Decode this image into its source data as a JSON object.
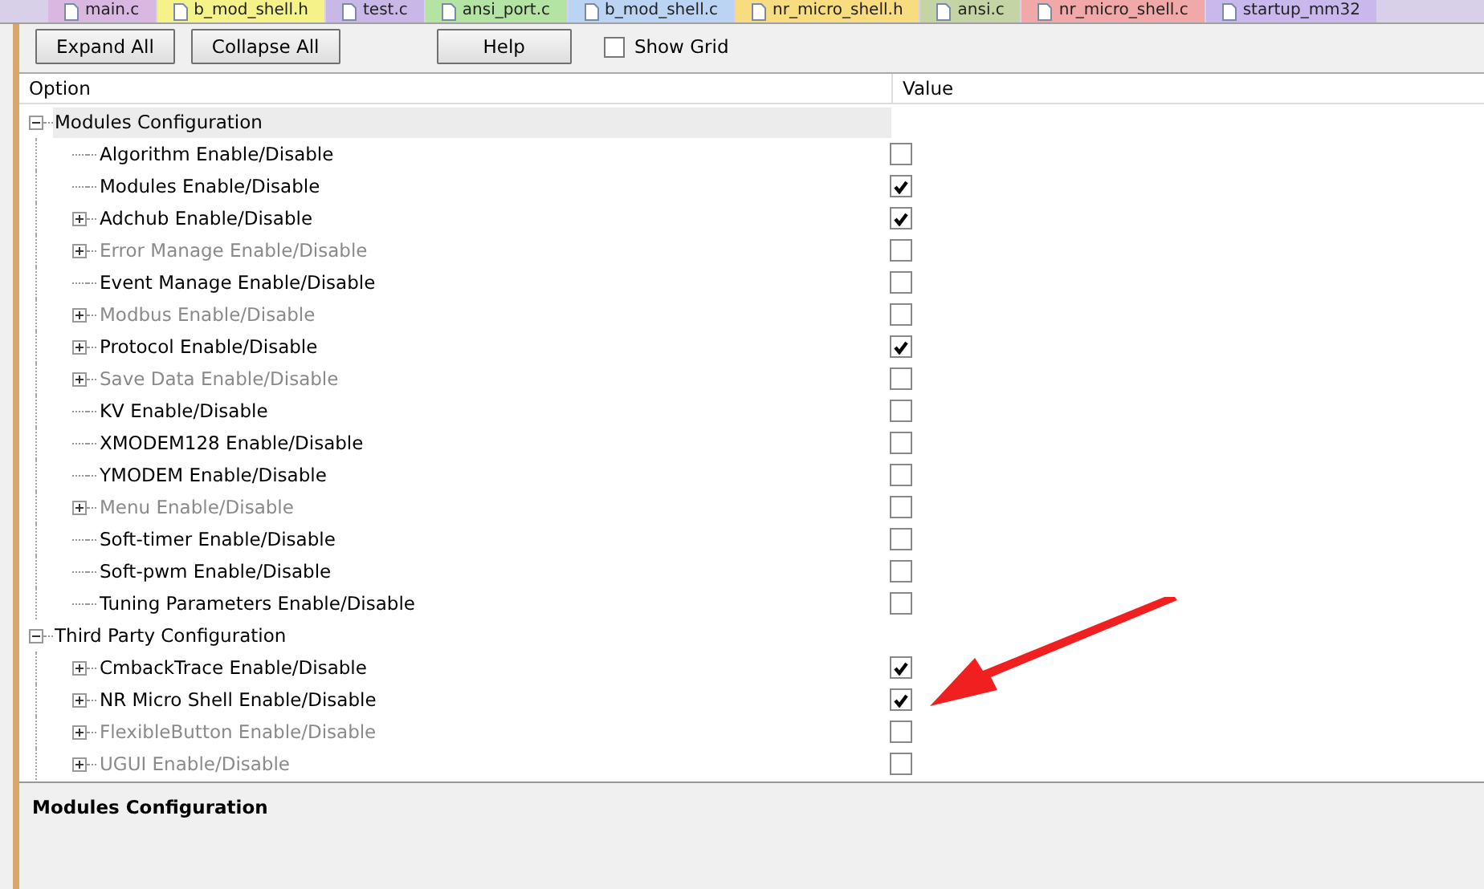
{
  "tabs": [
    {
      "label": "main.c",
      "color": "#d8b8e0"
    },
    {
      "label": "b_mod_shell.h",
      "color": "#f6f28a"
    },
    {
      "label": "test.c",
      "color": "#c8b8e8"
    },
    {
      "label": "ansi_port.c",
      "color": "#b4e4a4"
    },
    {
      "label": "b_mod_shell.c",
      "color": "#bcd4f4"
    },
    {
      "label": "nr_micro_shell.h",
      "color": "#f8dc80"
    },
    {
      "label": "ansi.c",
      "color": "#c4d4a4"
    },
    {
      "label": "nr_micro_shell.c",
      "color": "#f0a8a8"
    },
    {
      "label": "startup_mm32",
      "color": "#c8b8ec"
    }
  ],
  "toolbar": {
    "buttons": [
      "Expand All",
      "Collapse All",
      "Help"
    ],
    "show_grid": {
      "label": "Show Grid",
      "checked": false
    }
  },
  "table": {
    "columns": [
      "Option",
      "Value"
    ],
    "groups": [
      {
        "label": "Modules Configuration",
        "expanded": true,
        "selected": true,
        "children": [
          {
            "label": "Algorithm Enable/Disable",
            "kind": "leaf",
            "disabled": false,
            "checked": false
          },
          {
            "label": "Modules Enable/Disable",
            "kind": "leaf",
            "disabled": false,
            "checked": true
          },
          {
            "label": "Adchub Enable/Disable",
            "kind": "branch",
            "disabled": false,
            "checked": true
          },
          {
            "label": "Error Manage Enable/Disable",
            "kind": "branch",
            "disabled": true,
            "checked": false
          },
          {
            "label": "Event Manage Enable/Disable",
            "kind": "leaf",
            "disabled": false,
            "checked": false
          },
          {
            "label": "Modbus Enable/Disable",
            "kind": "branch",
            "disabled": true,
            "checked": false
          },
          {
            "label": "Protocol Enable/Disable",
            "kind": "branch",
            "disabled": false,
            "checked": true
          },
          {
            "label": "Save Data Enable/Disable",
            "kind": "branch",
            "disabled": true,
            "checked": false
          },
          {
            "label": "KV Enable/Disable",
            "kind": "leaf",
            "disabled": false,
            "checked": false
          },
          {
            "label": "XMODEM128 Enable/Disable",
            "kind": "leaf",
            "disabled": false,
            "checked": false
          },
          {
            "label": "YMODEM Enable/Disable",
            "kind": "leaf",
            "disabled": false,
            "checked": false
          },
          {
            "label": "Menu Enable/Disable",
            "kind": "branch",
            "disabled": true,
            "checked": false
          },
          {
            "label": "Soft-timer Enable/Disable",
            "kind": "leaf",
            "disabled": false,
            "checked": false
          },
          {
            "label": "Soft-pwm Enable/Disable",
            "kind": "leaf",
            "disabled": false,
            "checked": false
          },
          {
            "label": "Tuning Parameters Enable/Disable",
            "kind": "leaf",
            "disabled": false,
            "checked": false
          }
        ]
      },
      {
        "label": "Third Party Configuration",
        "expanded": true,
        "selected": false,
        "children": [
          {
            "label": "CmbackTrace Enable/Disable",
            "kind": "branch",
            "disabled": false,
            "checked": true
          },
          {
            "label": "NR Micro Shell Enable/Disable",
            "kind": "branch",
            "disabled": false,
            "checked": true
          },
          {
            "label": "FlexibleButton Enable/Disable",
            "kind": "branch",
            "disabled": true,
            "checked": false
          },
          {
            "label": "UGUI Enable/Disable",
            "kind": "branch",
            "disabled": true,
            "checked": false
          }
        ]
      }
    ]
  },
  "description": "Modules Configuration"
}
